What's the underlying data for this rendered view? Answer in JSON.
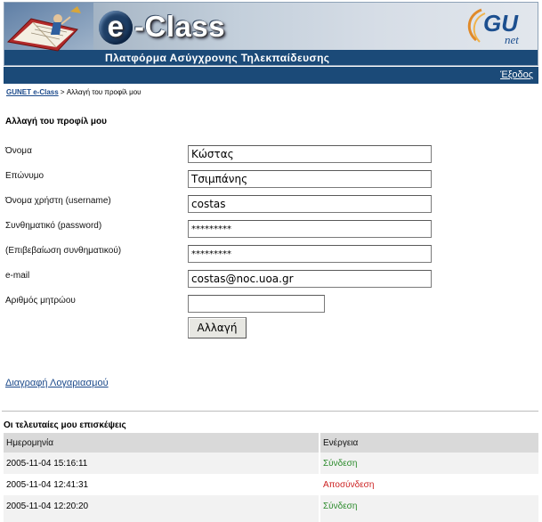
{
  "header": {
    "logo_text": "-Class",
    "logo_e": "e",
    "subtitle": "Πλατφόρμα Ασύγχρονης Τηλεκπαίδευσης",
    "gunet_text": "GU",
    "gunet_sub": "net"
  },
  "topbar": {
    "logout_label": "Έξοδος"
  },
  "breadcrumb": {
    "home_label": "GUNET e-Class",
    "separator": " > ",
    "current": "Αλλαγή του προφίλ μου"
  },
  "form": {
    "title": "Αλλαγή του προφίλ μου",
    "fields": {
      "first_name": {
        "label": "Όνομα",
        "value": "Κώστας"
      },
      "last_name": {
        "label": "Επώνυμο",
        "value": "Τσιμπάνης"
      },
      "username": {
        "label": "Όνομα χρήστη (username)",
        "value": "costas"
      },
      "password": {
        "label": "Συνθηματικό (password)",
        "value": "*********"
      },
      "password_confirm": {
        "label": "(Επιβεβαίωση συνθηματικού)",
        "value": "*********"
      },
      "email": {
        "label": "e-mail",
        "value": "costas@noc.uoa.gr"
      },
      "registration_number": {
        "label": "Αριθμός μητρώου",
        "value": ""
      }
    },
    "submit_label": "Αλλαγή",
    "delete_account_label": "Διαγραφή Λογαριασμού"
  },
  "visits": {
    "title": "Οι τελευταίες μου επισκέψεις",
    "columns": [
      "Ημερομηνία",
      "Ενέργεια"
    ],
    "rows": [
      {
        "date": "2005-11-04 15:16:11",
        "action": "Σύνδεση",
        "action_color": "#2a8a2a"
      },
      {
        "date": "2005-11-04 12:41:31",
        "action": "Αποσύνδεση",
        "action_color": "#cc2222"
      },
      {
        "date": "2005-11-04 12:20:20",
        "action": "Σύνδεση",
        "action_color": "#2a8a2a"
      }
    ]
  },
  "colors": {
    "header_bar": "#1b4a78",
    "link": "#1c4a8b",
    "table_header": "#d9d9d9"
  }
}
